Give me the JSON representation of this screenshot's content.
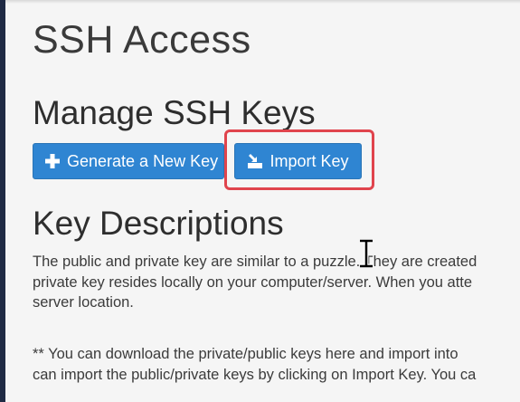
{
  "page": {
    "title": "SSH Access"
  },
  "manage": {
    "heading": "Manage SSH Keys",
    "generate_button": "Generate a New Key",
    "import_button": "Import Key"
  },
  "descriptions": {
    "heading": "Key Descriptions",
    "para1_lines": [
      "The public and private key are similar to a puzzle. They are created",
      "private key resides locally on your computer/server. When you atte",
      "server location."
    ],
    "para2_lines": [
      "** You can download the private/public keys here and import into",
      "can import the public/private keys by clicking on Import Key. You ca"
    ]
  },
  "icons": {
    "generate": "plus-icon",
    "import": "import-icon",
    "cursor": "text-cursor-icon"
  },
  "colors": {
    "button_bg": "#2f85d2",
    "highlight": "#e0444d",
    "sidebar": "#1f2a44"
  }
}
